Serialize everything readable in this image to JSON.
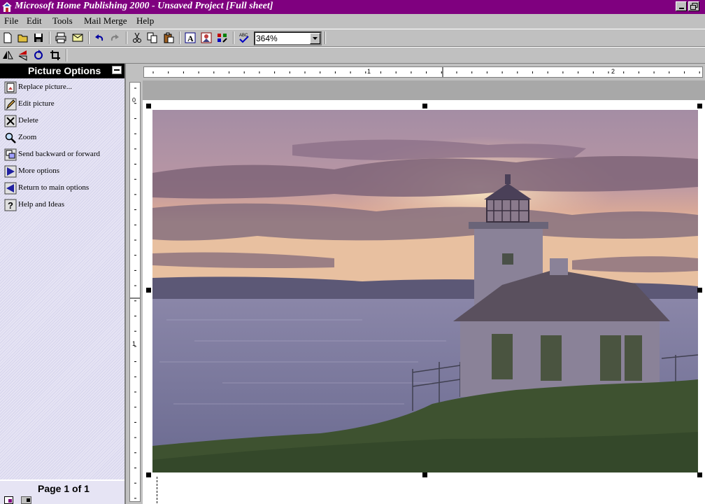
{
  "window": {
    "title": "Microsoft Home Publishing 2000 - Unsaved Project [Full sheet]"
  },
  "menu": [
    {
      "label": "File"
    },
    {
      "label": "Edit"
    },
    {
      "label": "Tools"
    },
    {
      "label": "Mail Merge"
    },
    {
      "label": "Help"
    }
  ],
  "toolbar": {
    "zoom_value": "364%"
  },
  "panel": {
    "title": "Picture Options",
    "options": [
      {
        "label": "Replace picture...",
        "icon": "replace-picture-icon"
      },
      {
        "label": "Edit picture",
        "icon": "pencil-icon"
      },
      {
        "label": "Delete",
        "icon": "delete-x-icon"
      },
      {
        "label": "Zoom",
        "icon": "magnifier-icon"
      },
      {
        "label": "Send backward or forward",
        "icon": "send-backward-icon"
      },
      {
        "label": "More options",
        "icon": "arrow-right-icon"
      },
      {
        "label": "Return to main options",
        "icon": "arrow-left-icon"
      },
      {
        "label": "Help and Ideas",
        "icon": "help-icon"
      }
    ],
    "page_indicator": "Page 1 of 1"
  },
  "ruler": {
    "h_marks": [
      "1",
      "2"
    ],
    "v_marks": [
      "0",
      "1"
    ]
  },
  "colors": {
    "titlebar": "#7f007f",
    "panel_bg": "#e6e4f4"
  }
}
